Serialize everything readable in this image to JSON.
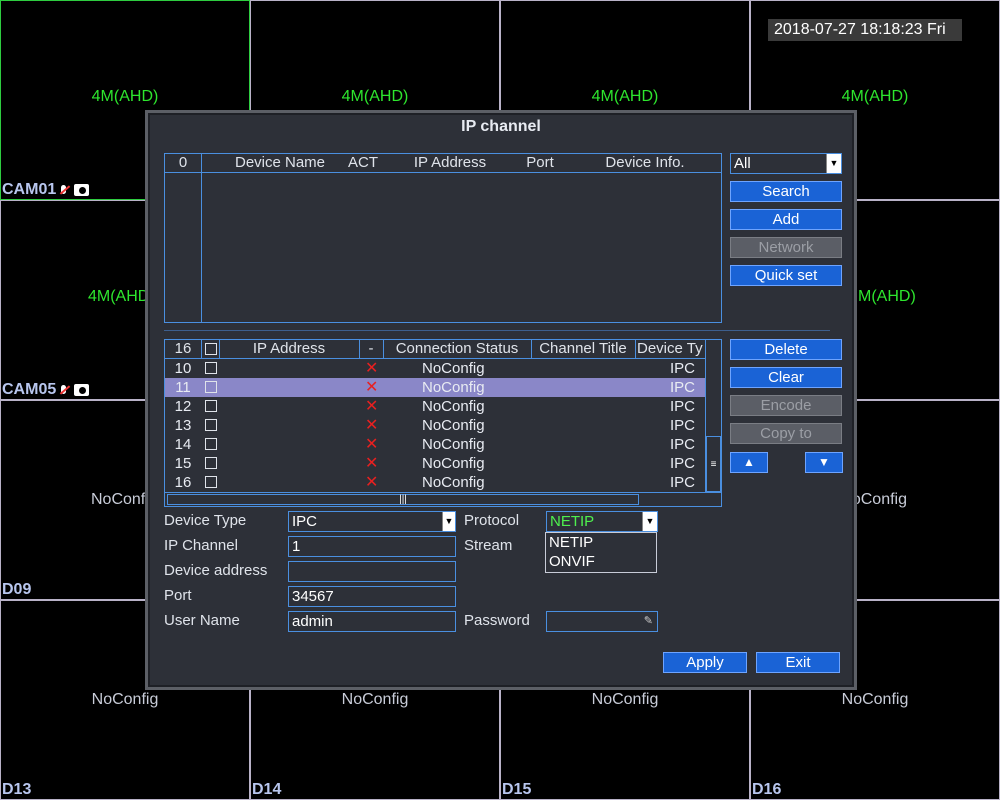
{
  "datetime": "2018-07-27 18:18:23 Fri",
  "cells": [
    {
      "res": "4M(AHD)",
      "name": "CAM01",
      "icons": true
    },
    {
      "res": "4M(AHD)",
      "name": "",
      "icons": false
    },
    {
      "res": "4M(AHD)",
      "name": "",
      "icons": false
    },
    {
      "res": "4M(AHD)",
      "name": "",
      "icons": false
    },
    {
      "res": "4M(AHD",
      "name": "CAM05",
      "icons": true
    },
    {
      "res": "",
      "name": "",
      "icons": false
    },
    {
      "res": "",
      "name": "",
      "icons": false
    },
    {
      "res": "M(AHD)",
      "name": "",
      "icons": false
    },
    {
      "nocfg": "NoConf",
      "name": "D09"
    },
    {
      "nocfg": "",
      "name": ""
    },
    {
      "nocfg": "",
      "name": ""
    },
    {
      "nocfg": "oConfig",
      "name": ""
    },
    {
      "nocfg": "NoConfig",
      "name": "D13"
    },
    {
      "nocfg": "NoConfig",
      "name": "D14"
    },
    {
      "nocfg": "NoConfig",
      "name": "D15"
    },
    {
      "nocfg": "NoConfig",
      "name": "D16"
    }
  ],
  "dialog": {
    "title": "IP channel",
    "search_table": {
      "headers": [
        "0",
        "Device Name",
        "ACT",
        "IP Address",
        "Port",
        "Device Info."
      ]
    },
    "filter": {
      "value": "All"
    },
    "buttons_top": {
      "search": "Search",
      "add": "Add",
      "network": "Network",
      "quick_set": "Quick set"
    },
    "channel_table": {
      "headers": [
        "16",
        "IP Address",
        "-",
        "Connection Status",
        "Channel Title",
        "Device Ty"
      ],
      "rows": [
        {
          "ch": "10",
          "status": "NoConfig",
          "type": "IPC",
          "highlight": false
        },
        {
          "ch": "11",
          "status": "NoConfig",
          "type": "IPC",
          "highlight": true
        },
        {
          "ch": "12",
          "status": "NoConfig",
          "type": "IPC",
          "highlight": false
        },
        {
          "ch": "13",
          "status": "NoConfig",
          "type": "IPC",
          "highlight": false
        },
        {
          "ch": "14",
          "status": "NoConfig",
          "type": "IPC",
          "highlight": false
        },
        {
          "ch": "15",
          "status": "NoConfig",
          "type": "IPC",
          "highlight": false
        },
        {
          "ch": "16",
          "status": "NoConfig",
          "type": "IPC",
          "highlight": false
        }
      ],
      "status_icon": "x-mark-icon"
    },
    "buttons_mid": {
      "delete": "Delete",
      "clear": "Clear",
      "encode": "Encode",
      "copy_to": "Copy to",
      "up": "▲",
      "down": "▼"
    },
    "form": {
      "device_type_label": "Device Type",
      "device_type_value": "IPC",
      "protocol_label": "Protocol",
      "protocol_value": "NETIP",
      "ip_channel_label": "IP Channel",
      "ip_channel_value": "1",
      "stream_label": "Stream",
      "device_address_label": "Device address",
      "device_address_value": "",
      "port_label": "Port",
      "port_value": "34567",
      "user_name_label": "User Name",
      "user_name_value": "admin",
      "password_label": "Password",
      "password_value": ""
    },
    "protocol_options": [
      "NETIP",
      "ONVIF"
    ],
    "buttons_bottom": {
      "apply": "Apply",
      "exit": "Exit"
    }
  },
  "colors": {
    "accent": "#1a63d6",
    "resolution_text": "#2ee62e",
    "error": "#e82020",
    "highlight_row": "#8a87c8"
  }
}
